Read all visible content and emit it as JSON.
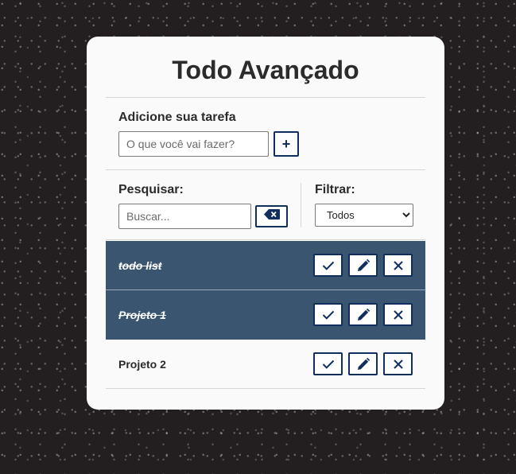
{
  "app": {
    "title": "Todo Avançado"
  },
  "add": {
    "label": "Adicione sua tarefa",
    "placeholder": "O que você vai fazer?",
    "button_label": "+"
  },
  "search": {
    "label": "Pesquisar:",
    "placeholder": "Buscar...",
    "clear_icon": "backspace-icon"
  },
  "filter": {
    "label": "Filtrar:",
    "selected": "Todos"
  },
  "todos": [
    {
      "text": "todo list",
      "done": true
    },
    {
      "text": "Projeto 1",
      "done": true
    },
    {
      "text": "Projeto 2",
      "done": false
    }
  ],
  "actions": [
    "check-icon",
    "pencil-icon",
    "close-icon"
  ],
  "colors": {
    "accent": "#102f5e",
    "done_row": "#3a5570",
    "background": "#231f20"
  }
}
